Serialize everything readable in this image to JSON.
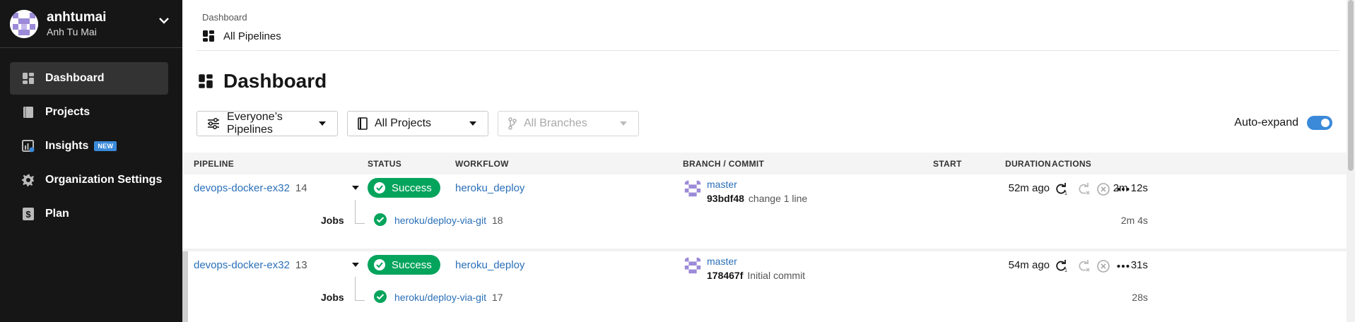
{
  "org": {
    "name": "anhtumai",
    "user": "Anh Tu Mai"
  },
  "sidebar": {
    "items": [
      {
        "label": "Dashboard",
        "icon": "dashboard-icon",
        "active": true
      },
      {
        "label": "Projects",
        "icon": "book-icon"
      },
      {
        "label": "Insights",
        "icon": "insights-icon",
        "badge": "NEW"
      },
      {
        "label": "Organization Settings",
        "icon": "gear-icon"
      },
      {
        "label": "Plan",
        "icon": "dollar-icon"
      }
    ]
  },
  "breadcrumb": {
    "parent": "Dashboard",
    "current": "All Pipelines"
  },
  "page": {
    "title": "Dashboard"
  },
  "filters": {
    "pipelines": "Everyone’s Pipelines",
    "projects": "All Projects",
    "branches": "All Branches",
    "auto_expand_label": "Auto-expand",
    "auto_expand_on": true
  },
  "table": {
    "headers": {
      "pipeline": "PIPELINE",
      "status": "STATUS",
      "workflow": "WORKFLOW",
      "branch": "BRANCH / COMMIT",
      "start": "START",
      "duration": "DURATION",
      "actions": "ACTIONS"
    },
    "jobs_label": "Jobs",
    "rows": [
      {
        "pipeline": "devops-docker-ex32",
        "number": "14",
        "status": "Success",
        "workflow": "heroku_deploy",
        "branch": "master",
        "sha": "93bdf48",
        "message": "change 1 line",
        "start": "52m ago",
        "duration": "2m 12s",
        "job": {
          "name": "heroku/deploy-via-git",
          "number": "18",
          "duration": "2m 4s"
        }
      },
      {
        "pipeline": "devops-docker-ex32",
        "number": "13",
        "status": "Success",
        "workflow": "heroku_deploy",
        "branch": "master",
        "sha": "178467f",
        "message": "Initial commit",
        "start": "54m ago",
        "duration": "31s",
        "job": {
          "name": "heroku/deploy-via-git",
          "number": "17",
          "duration": "28s"
        }
      }
    ]
  },
  "colors": {
    "success": "#05a45c",
    "link": "#2a6fb8",
    "sidebar": "#161616",
    "accent": "#3b8ad9"
  }
}
